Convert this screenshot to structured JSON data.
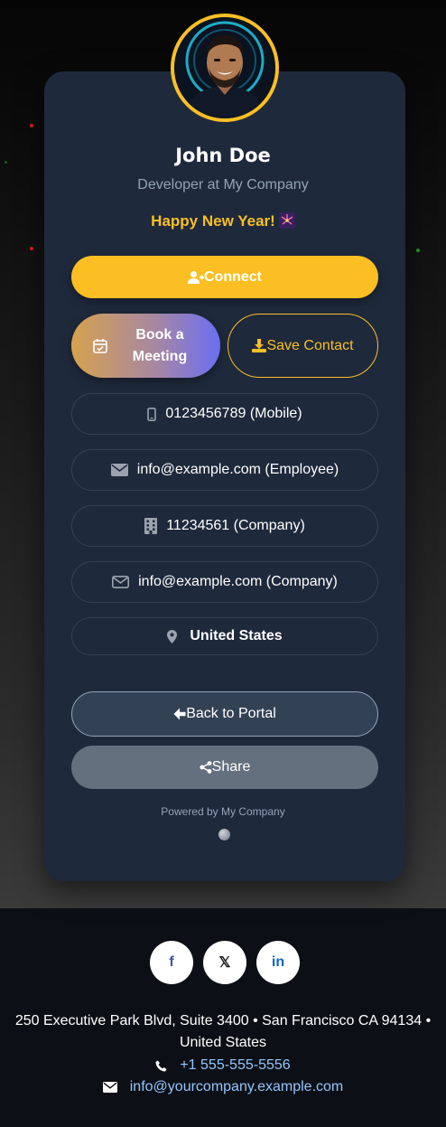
{
  "profile": {
    "name": "John Doe",
    "role": "Developer at My Company",
    "greeting": "Happy New Year!"
  },
  "actions": {
    "connect": "Connect",
    "book_meeting": "Book a Meeting",
    "save_contact": "Save Contact",
    "back_to_portal": "Back to Portal",
    "share": "Share"
  },
  "contacts": [
    {
      "icon": "mobile-icon",
      "text": "0123456789 (Mobile)"
    },
    {
      "icon": "envelope-icon",
      "text": "info@example.com (Employee)"
    },
    {
      "icon": "building-icon",
      "text": "11234561 (Company)"
    },
    {
      "icon": "envelope-outline-icon",
      "text": "info@example.com (Company)"
    },
    {
      "icon": "location-pin-icon",
      "text": "United States"
    }
  ],
  "powered_by": "Powered by My Company",
  "footer": {
    "social": [
      {
        "icon": "facebook-icon",
        "glyph": "f"
      },
      {
        "icon": "x-icon",
        "glyph": "𝕏"
      },
      {
        "icon": "linkedin-icon",
        "glyph": "in"
      }
    ],
    "address": "250 Executive Park Blvd, Suite 3400 • San Francisco CA 94134 • United States",
    "phone": "+1 555-555-5556",
    "email": "info@yourcompany.example.com"
  },
  "colors": {
    "accent": "#fbbf24",
    "card": "#1e293b",
    "link": "#93c5fd"
  }
}
